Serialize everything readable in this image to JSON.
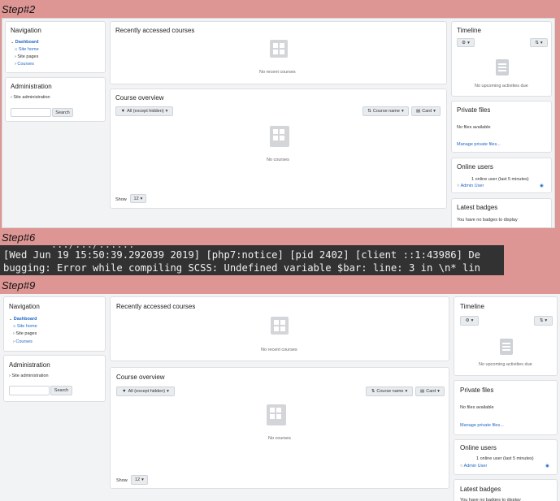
{
  "steps": {
    "step2": "Step#2",
    "step6": "Step#6",
    "step9": "Step#9"
  },
  "moodle": {
    "navigation": {
      "title": "Navigation",
      "dashboard": "Dashboard",
      "site_home": "Site home",
      "site_pages": "Site pages",
      "courses": "Courses"
    },
    "administration": {
      "title": "Administration",
      "site_admin": "Site administration",
      "search_button": "Search",
      "search_value": ""
    },
    "recent": {
      "title": "Recently accessed courses",
      "empty": "No recent courses"
    },
    "overview": {
      "title": "Course overview",
      "filter": "All (except hidden)",
      "sort": "Course name",
      "view": "Card",
      "empty": "No courses",
      "show_label": "Show",
      "show_value": "12"
    },
    "timeline": {
      "title": "Timeline",
      "empty": "No upcoming activities due"
    },
    "private_files": {
      "title": "Private files",
      "empty": "No files available",
      "manage": "Manage private files..."
    },
    "online_users": {
      "title": "Online users",
      "summary": "1 online user (last 5 minutes)",
      "user": "Admin User"
    },
    "badges": {
      "title": "Latest badges",
      "empty": "You have no badges to display"
    }
  },
  "terminal": {
    "line0": "        .../.../......",
    "line1": "[Wed Jun 19 15:50:39.292039 2019] [php7:notice] [pid 2402] [client ::1:43986] De",
    "line2": "bugging: Error while compiling SCSS: Undefined variable $bar: line: 3 in \\n* lin"
  },
  "icons": [
    "home-icon",
    "chevron-down-icon",
    "chevron-right-icon",
    "filter-icon",
    "sort-icon",
    "list-icon",
    "gear-icon",
    "eye-icon",
    "timeline-icon",
    "course-icon"
  ],
  "colors": {
    "background": "#dd9694",
    "link": "#1f66c5",
    "terminal_bg": "#323232"
  }
}
